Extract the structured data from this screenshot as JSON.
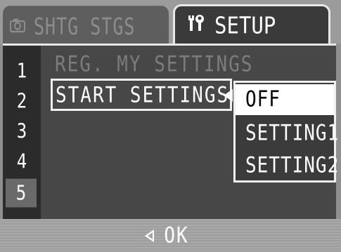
{
  "tabs": {
    "shooting": {
      "label": "SHTG STGS",
      "icon": "camera-icon"
    },
    "setup": {
      "label": "SETUP",
      "icon": "tools-icon"
    }
  },
  "pages": [
    "1",
    "2",
    "3",
    "4",
    "5"
  ],
  "active_page": "5",
  "menu": {
    "items": [
      {
        "label": "REG. MY SETTINGS",
        "enabled": false
      },
      {
        "label": "START SETTINGS",
        "enabled": true,
        "selected": true
      }
    ]
  },
  "dropdown": {
    "options": [
      "OFF",
      "SETTING1",
      "SETTING2"
    ],
    "selected": "OFF"
  },
  "footer": {
    "hint": "OK",
    "icon": "left-arrow-icon"
  },
  "colors": {
    "highlight": "#ffffff",
    "panel": "#3b3b3b",
    "frame": "#8f8f8f"
  }
}
